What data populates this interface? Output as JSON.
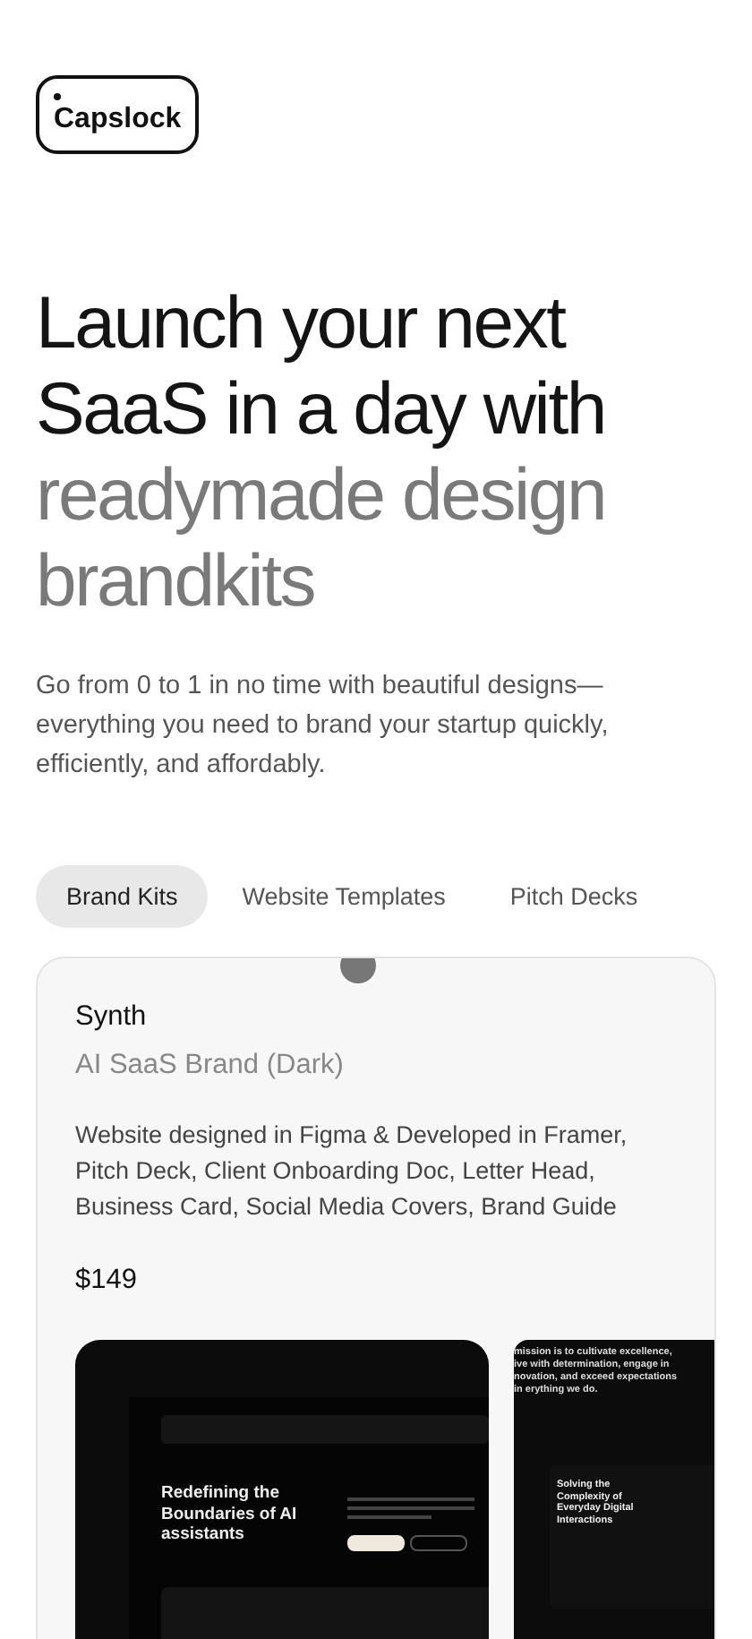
{
  "logo": {
    "text": "Capslock"
  },
  "hero": {
    "headline_dark": [
      "Launch your next",
      "SaaS in a day with"
    ],
    "headline_muted": [
      "readymade design",
      "brandkits"
    ],
    "description": "Go from 0 to 1 in no time with beautiful designs—everything you need to brand your startup quickly, efficiently, and affordably."
  },
  "tabs": [
    {
      "label": "Brand Kits",
      "selected": true
    },
    {
      "label": "Website Templates",
      "selected": false
    },
    {
      "label": "Pitch Decks",
      "selected": false
    }
  ],
  "card": {
    "title": "Synth",
    "subtitle": "AI SaaS Brand (Dark)",
    "description": "Website designed in Figma & Developed in Framer, Pitch Deck, Client Onboarding Doc, Letter Head, Business Card, Social Media Covers, Brand Guide",
    "price": "$149",
    "previews": [
      {
        "kind": "website",
        "headline": "Redefining the Boundaries of AI assistants"
      },
      {
        "kind": "deck",
        "mission": "mission is to cultivate excellence, ive with determination, engage in novation, and exceed expectations in erything we do.",
        "headline": "Solving the Complexity of Everyday Digital Interactions"
      }
    ]
  }
}
